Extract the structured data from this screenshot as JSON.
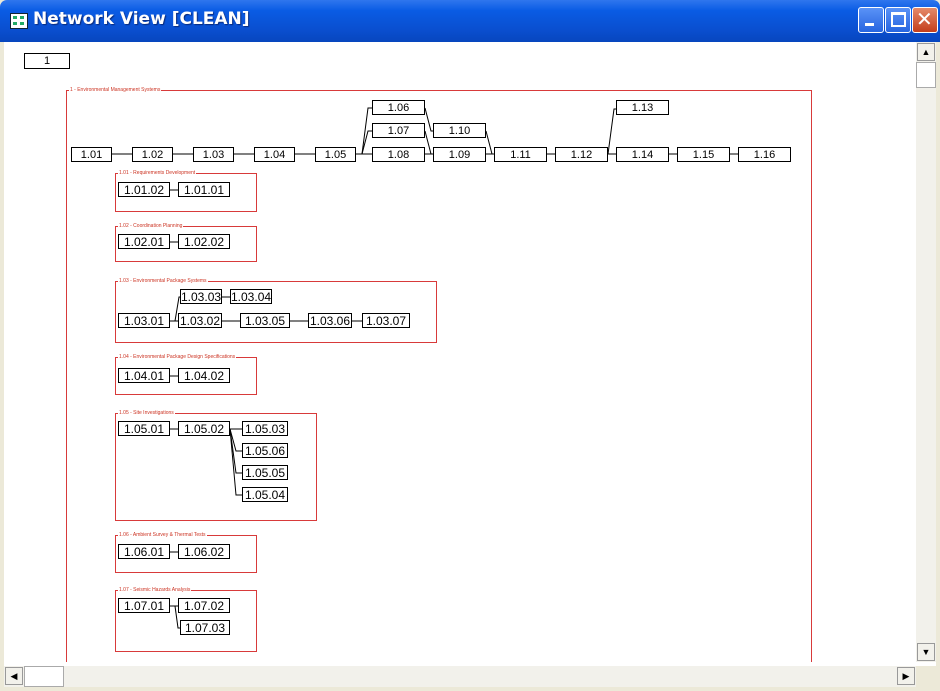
{
  "window": {
    "title": "Network View [CLEAN]"
  },
  "page_number": "1",
  "outer_group": {
    "label": "1 - Environmental Management Systems"
  },
  "main_nodes": [
    "1.01",
    "1.02",
    "1.03",
    "1.04",
    "1.05",
    "1.06",
    "1.07",
    "1.08",
    "1.09",
    "1.10",
    "1.11",
    "1.12",
    "1.13",
    "1.14",
    "1.15",
    "1.16"
  ],
  "groups": [
    {
      "label": "1.01 - Requirements Development",
      "nodes": [
        "1.01.02",
        "1.01.01"
      ]
    },
    {
      "label": "1.02 - Coordination Planning",
      "nodes": [
        "1.02.01",
        "1.02.02"
      ]
    },
    {
      "label": "1.03 - Environmental Package Systems",
      "nodes": [
        "1.03.01",
        "1.03.02",
        "1.03.03",
        "1.03.04",
        "1.03.05",
        "1.03.06",
        "1.03.07"
      ]
    },
    {
      "label": "1.04 - Environmental Package Design Specifications",
      "nodes": [
        "1.04.01",
        "1.04.02"
      ]
    },
    {
      "label": "1.05 - Site Investigations",
      "nodes": [
        "1.05.01",
        "1.05.02",
        "1.05.03",
        "1.05.06",
        "1.05.05",
        "1.05.04"
      ]
    },
    {
      "label": "1.06 - Ambient Survey & Thermal Tests",
      "nodes": [
        "1.06.01",
        "1.06.02"
      ]
    },
    {
      "label": "1.07 - Seismic Hazards Analysis",
      "nodes": [
        "1.07.01",
        "1.07.02",
        "1.07.03"
      ]
    }
  ],
  "colors": {
    "titlebar": "#0A4FD0",
    "group_border": "#D83A3A",
    "window_frame": "#ECE9D8"
  },
  "icons": {
    "title": "network-view-icon",
    "minimize": "minimize-icon",
    "maximize": "maximize-icon",
    "close": "close-icon"
  }
}
